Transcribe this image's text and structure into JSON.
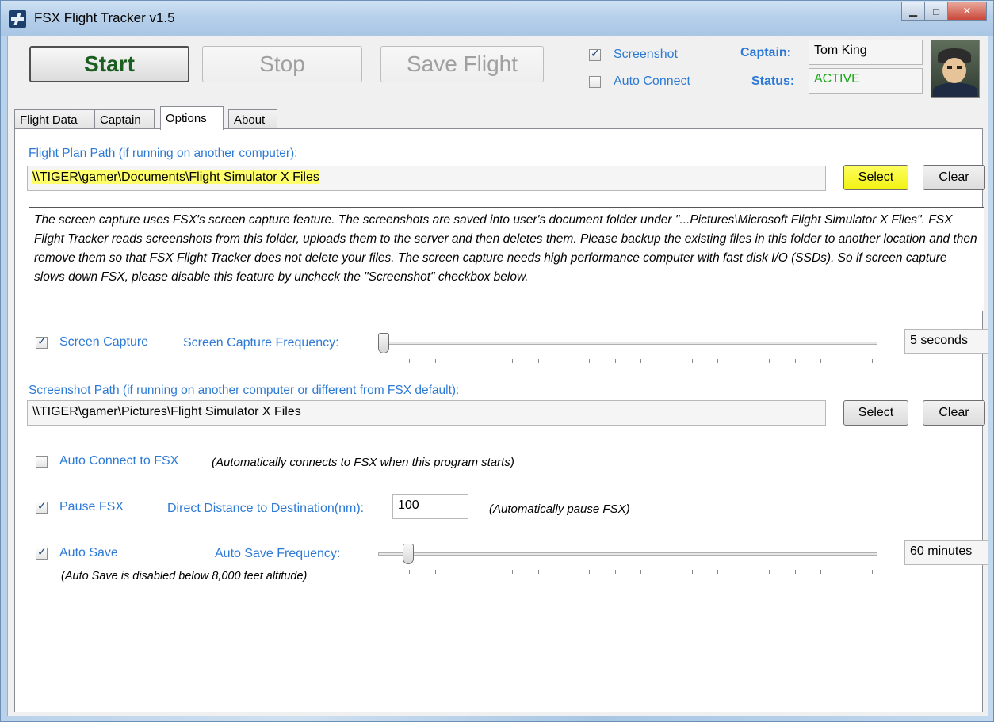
{
  "window": {
    "title": "FSX Flight Tracker v1.5",
    "controls": {
      "minimize": "▁",
      "maximize": "□",
      "close": "✕"
    }
  },
  "toolbar": {
    "start_label": "Start",
    "stop_label": "Stop",
    "save_label": "Save Flight",
    "screenshot_label": "Screenshot",
    "screenshot_checked": true,
    "auto_connect_label": "Auto Connect",
    "auto_connect_checked": false
  },
  "captain": {
    "captain_label": "Captain:",
    "captain_value": "Tom King",
    "status_label": "Status:",
    "status_value": "ACTIVE",
    "status_color": "#17a817",
    "avatar_icon": "pilot-avatar-icon"
  },
  "tabs": [
    {
      "label": "Flight Data",
      "active": false
    },
    {
      "label": "Captain",
      "active": false
    },
    {
      "label": "Options",
      "active": true
    },
    {
      "label": "About",
      "active": false
    }
  ],
  "options": {
    "flight_plan_path_label": "Flight Plan Path (if running on another computer):",
    "flight_plan_path_value": "\\\\TIGER\\gamer\\Documents\\Flight Simulator X Files",
    "select_label": "Select",
    "clear_label": "Clear",
    "info_text": "The screen capture uses FSX's screen capture feature.  The screenshots are saved into user's document folder under \"...Pictures\\Microsoft Flight Simulator X Files\".  FSX Flight Tracker reads screenshots from this folder, uploads them to the server and then deletes them.  Please backup the existing files in this folder to another location and then remove them so that FSX Flight Tracker does not delete your files.  The screen capture needs high performance computer with fast disk I/O (SSDs).  So if screen capture slows down FSX, please disable this feature by uncheck the \"Screenshot\" checkbox below.",
    "screen_capture_label": "Screen Capture",
    "screen_capture_checked": true,
    "screen_capture_freq_label": "Screen Capture Frequency:",
    "screen_capture_freq_value": "5 seconds",
    "screen_capture_freq_fraction": 0.0,
    "screenshot_path_label": "Screenshot Path (if running on another computer or different from FSX default):",
    "screenshot_path_value": "\\\\TIGER\\gamer\\Pictures\\Flight Simulator X Files",
    "auto_connect_fsx_label": "Auto Connect to FSX",
    "auto_connect_fsx_checked": false,
    "auto_connect_fsx_note": "(Automatically connects to FSX when this program starts)",
    "pause_fsx_label": "Pause FSX",
    "pause_fsx_checked": true,
    "direct_distance_label": "Direct Distance to Destination(nm):",
    "direct_distance_value": "100",
    "pause_note": "(Automatically pause FSX)",
    "auto_save_label": "Auto Save",
    "auto_save_checked": true,
    "auto_save_freq_label": "Auto Save Frequency:",
    "auto_save_freq_value": "60 minutes",
    "auto_save_freq_fraction": 0.05,
    "auto_save_note": "(Auto Save is disabled below 8,000 feet altitude)"
  }
}
